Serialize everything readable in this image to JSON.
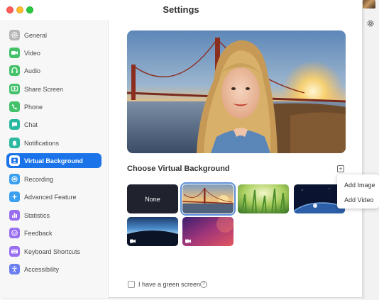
{
  "window": {
    "title": "Settings"
  },
  "sidebar": {
    "items": [
      {
        "id": "general",
        "label": "General",
        "icon": "gear-icon",
        "color": "#b8b8b8"
      },
      {
        "id": "video",
        "label": "Video",
        "icon": "video-camera-icon",
        "color": "#43c26a"
      },
      {
        "id": "audio",
        "label": "Audio",
        "icon": "headphones-icon",
        "color": "#43c26a"
      },
      {
        "id": "share-screen",
        "label": "Share Screen",
        "icon": "share-screen-icon",
        "color": "#43c26a"
      },
      {
        "id": "phone",
        "label": "Phone",
        "icon": "phone-icon",
        "color": "#43c26a"
      },
      {
        "id": "chat",
        "label": "Chat",
        "icon": "chat-bubble-icon",
        "color": "#2bb8a0"
      },
      {
        "id": "notifications",
        "label": "Notifications",
        "icon": "bell-icon",
        "color": "#2bb8a0"
      },
      {
        "id": "virtual-background",
        "label": "Virtual Background",
        "icon": "person-portrait-icon",
        "color": "#ffffff",
        "active": true
      },
      {
        "id": "recording",
        "label": "Recording",
        "icon": "record-icon",
        "color": "#3a9ff0"
      },
      {
        "id": "advanced-feature",
        "label": "Advanced Feature",
        "icon": "sparkle-icon",
        "color": "#3a9ff0"
      },
      {
        "id": "statistics",
        "label": "Statistics",
        "icon": "bar-chart-icon",
        "color": "#9a6ef0"
      },
      {
        "id": "feedback",
        "label": "Feedback",
        "icon": "smiley-icon",
        "color": "#9a6ef0"
      },
      {
        "id": "keyboard-shortcuts",
        "label": "Keyboard Shortcuts",
        "icon": "keyboard-icon",
        "color": "#9a6ef0"
      },
      {
        "id": "accessibility",
        "label": "Accessibility",
        "icon": "accessibility-icon",
        "color": "#6a7ff0"
      }
    ]
  },
  "main": {
    "heading": "Choose Virtual Background",
    "add_button": "+",
    "backgrounds": [
      {
        "id": "none",
        "label": "None",
        "type": "none"
      },
      {
        "id": "golden-gate",
        "label": "",
        "type": "image",
        "selected": true
      },
      {
        "id": "grass",
        "label": "",
        "type": "image"
      },
      {
        "id": "earth",
        "label": "",
        "type": "image"
      },
      {
        "id": "aurora",
        "label": "",
        "type": "video"
      },
      {
        "id": "purple",
        "label": "",
        "type": "video"
      }
    ],
    "add_menu": {
      "items": [
        "Add Image",
        "Add Video"
      ]
    },
    "green_screen": {
      "label": "I have a green screen",
      "checked": false,
      "help": "?"
    }
  },
  "colors": {
    "accent": "#1a73e8",
    "selected_outline": "#5b8dd6"
  }
}
